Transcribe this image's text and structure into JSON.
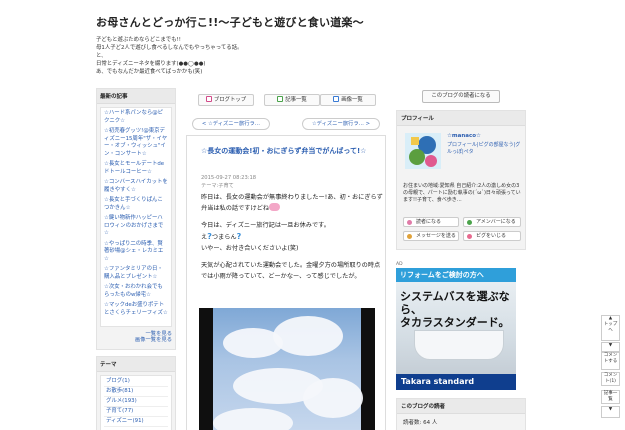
{
  "header": {
    "title": "お母さんとどっか行こ!!〜子どもと遊びと食い道楽〜",
    "desc": [
      "子どもと遊ぶためならどこまでも!!",
      "母1人子ど2人で遊びし食べるしなんでもやっちゃってる話。",
      "と、",
      "日常とディズニーネタを綴ります(●●◯●●)",
      "あ、でもなんだか最近食べてばっかかも(笑)"
    ]
  },
  "sidebar": {
    "recent_title": "最新の記事",
    "recent": [
      "☆ハード系パンなら@ピクニク☆",
      "☆初売春グッツ!@東京ディズニー15周年\"ザ・イヤー・オブ・ウィッシュ\"イン・コンサート☆",
      "☆長女とモールデートdeドトールコーヒー☆",
      "☆コンバースハイカットを履きやすく☆",
      "☆長女と手づくりぱんこつかきん☆",
      "☆鍵い物新作ハッピーハロウィンのおかげさまで☆",
      "☆やっぱり二の時季、賢著砂場@シェ・レカミエ☆",
      "☆ファンタミリアの日・購入品とプレゼント☆",
      "☆次女・おわかれ会でもらったものw帰宅☆",
      "☆マックdeお盛りポテトとさくらチェリーフィズ☆"
    ],
    "more1": "一覧を見る",
    "more2": "画像一覧を見る",
    "theme_title": "テーマ",
    "themes": [
      "ブログ(1)",
      "お散歩(81)",
      "グルメ(193)",
      "子育て(77)",
      "ディズニー(91)"
    ]
  },
  "toolbar": {
    "profile": "ブログトップ",
    "list": "記事一覧",
    "images": "画像一覧"
  },
  "pager": {
    "prev": "☆ディズニー旅行ラ…",
    "next": "☆ディズニー旅行ラ…"
  },
  "article": {
    "title": "☆長女の運動会!初・おにぎらず弁当でがんばって!☆",
    "date": "2015-09-27 08:23:18",
    "theme": "テーマ:子育て",
    "p1": "昨日は、長女の運動会が無事終わりましたー!あ、初・おにぎらず弁当は私の話ですけどね",
    "p2a": "今日は、ディズニー旅行記は一旦お休みです。",
    "p2b": "え",
    "p2c": "つまらん",
    "p2d": "いやー、お付き合いくださいよ(笑)",
    "p3": "天気が心配されていた運動会でした。金曜夕方の場所取りの時点では小雨が降っていて、どーかなー、って感じでしたが。"
  },
  "right": {
    "reader_btn": "このブログの読者になる",
    "profile_title": "プロフィール",
    "name": "☆manaco☆",
    "sub": "プロフィール|ピグの部屋なう|グルっぽ|ペタ",
    "info": "お住まいの地域:愛知県 自己紹介:2人の激しめ女の3の母親で、パートに励む執事の(´ω`)日々頑張っています!!子育て、食べ歩き…",
    "btn_reader": "読者になる",
    "btn_amember": "アメンバーになる",
    "btn_message": "メッセージを送る",
    "btn_pigg": "ピグをいじる",
    "ad_label": "AD",
    "ad_top": "リフォームをご検討の方へ",
    "ad_head1": "システムバスを選ぶなら、",
    "ad_head2": "タカラスタンダード。",
    "ad_brand": "Takara standard",
    "readers_title": "このブログの読者",
    "readers_count": "読者数: 64 人"
  },
  "floating": {
    "up": "▲",
    "top": "トップへ",
    "down": "▼",
    "comment": "コメントする",
    "comment_count": "コメント(1)",
    "list": "記事一覧"
  },
  "colors": {
    "accent": "#2a5db0",
    "ad_blue": "#2f9fda",
    "brand": "#0f3e8e"
  }
}
